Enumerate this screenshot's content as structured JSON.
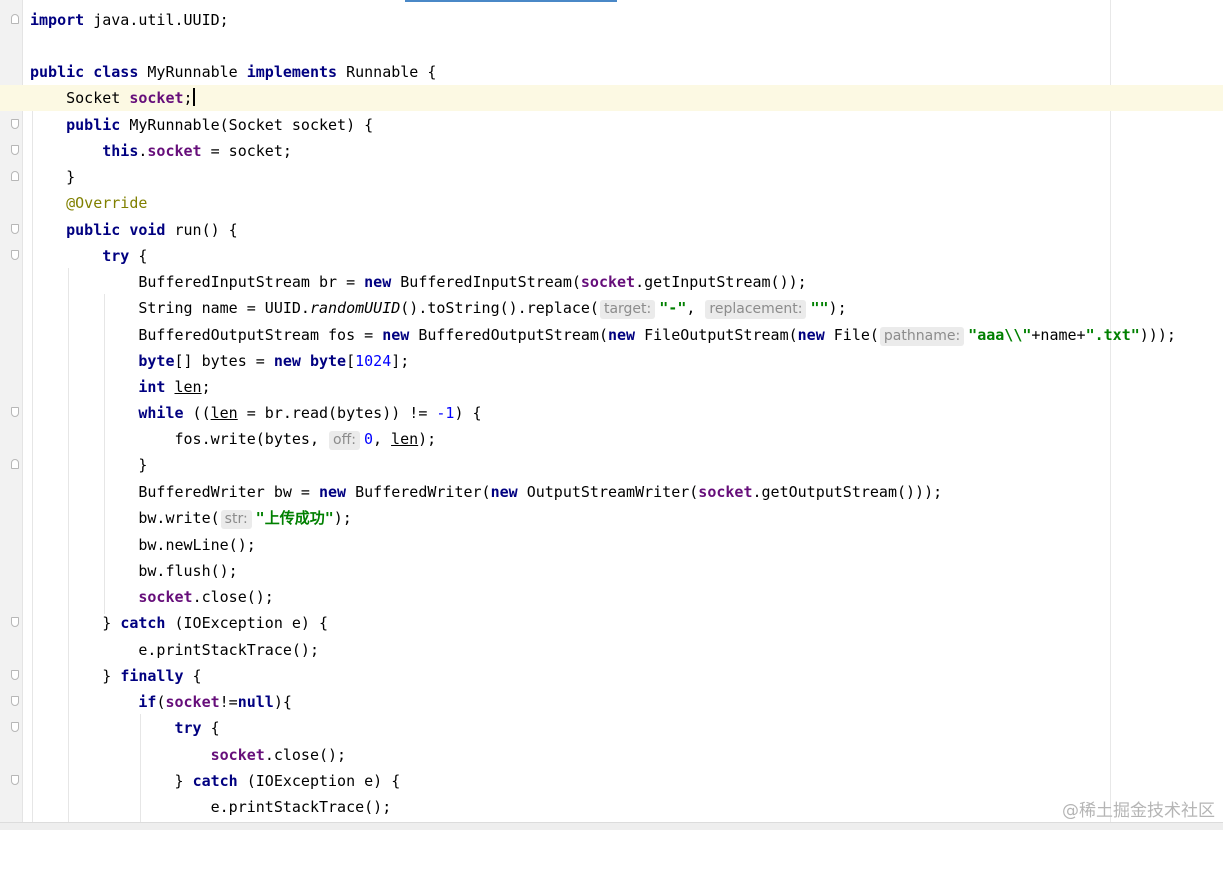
{
  "editor": {
    "language": "java",
    "lines": [
      "import java.util.UUID;",
      "",
      "public class MyRunnable implements Runnable {",
      "    Socket socket;",
      "    public MyRunnable(Socket socket) {",
      "        this.socket = socket;",
      "    }",
      "    @Override",
      "    public void run() {",
      "        try {",
      "            BufferedInputStream br = new BufferedInputStream(socket.getInputStream());",
      "            String name = UUID.randomUUID().toString().replace( target: \"-\",  replacement: \"\");",
      "            BufferedOutputStream fos = new BufferedOutputStream(new FileOutputStream(new File( pathname: \"aaa\\\\\"+name+\".txt\")));",
      "            byte[] bytes = new byte[1024];",
      "            int len;",
      "            while ((len = br.read(bytes)) != -1) {",
      "                fos.write(bytes,  off: 0, len);",
      "            }",
      "            BufferedWriter bw = new BufferedWriter(new OutputStreamWriter(socket.getOutputStream()));",
      "            bw.write( str: \"上传成功\");",
      "            bw.newLine();",
      "            bw.flush();",
      "            socket.close();",
      "        } catch (IOException e) {",
      "            e.printStackTrace();",
      "        } finally {",
      "            if(socket!=null){",
      "                try {",
      "                    socket.close();",
      "                } catch (IOException e) {",
      "                    e.printStackTrace();"
    ],
    "inlay_hints": {
      "target": "target:",
      "replacement": "replacement:",
      "pathname": "pathname:",
      "off": "off:",
      "str": "str:"
    },
    "current_line": 4,
    "colors": {
      "keyword": "#000080",
      "field": "#660e7a",
      "string": "#008000",
      "number": "#0000ff",
      "annotation": "#808000",
      "current_line_bg": "#fcf9e3",
      "tab_accent": "#4a88c7"
    }
  },
  "watermark": "@稀土掘金技术社区"
}
